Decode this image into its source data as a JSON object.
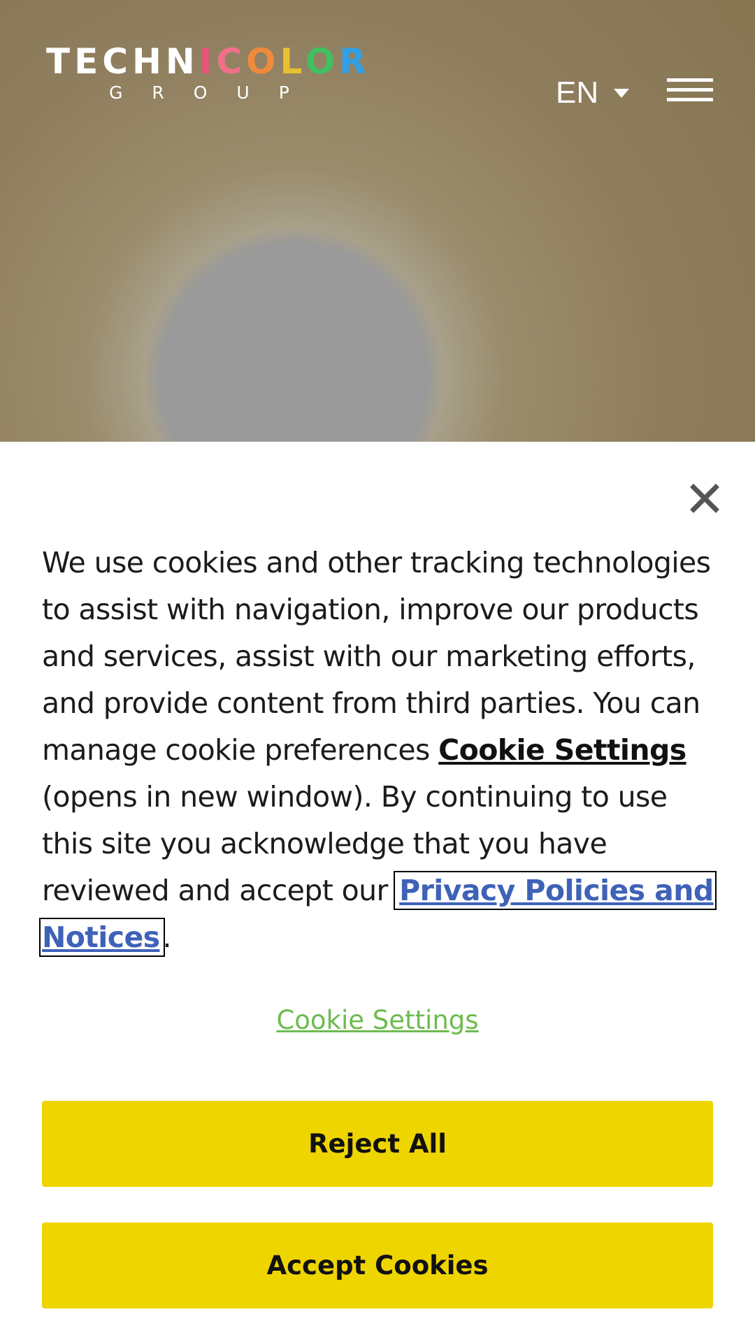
{
  "header": {
    "logo_main": [
      "TECH",
      "N",
      "I",
      "C",
      "O",
      "L",
      "O",
      "R"
    ],
    "logo_sub": "GROUP",
    "language": "EN",
    "icons": {
      "caret": "caret-down-icon",
      "menu": "hamburger-menu-icon"
    }
  },
  "cookie_banner": {
    "close_icon": "close-icon",
    "message": {
      "part1": "We use cookies and other tracking technologies to assist with navigation, improve our products and services, assist with our marketing efforts, and provide content from third parties. You can manage cookie preferences ",
      "settings_link": "Cookie Settings",
      "part2": " (opens in new window). By continuing to use this site you acknowledge that you have reviewed and accept our ",
      "privacy_link": "Privacy Policies and Notices",
      "part3": "."
    },
    "settings_link": "Cookie Settings",
    "reject_label": "Reject All",
    "accept_label": "Accept Cookies"
  },
  "colors": {
    "button_bg": "#efd500",
    "settings_link": "#6dbb4f",
    "privacy_link": "#3f62b8"
  }
}
